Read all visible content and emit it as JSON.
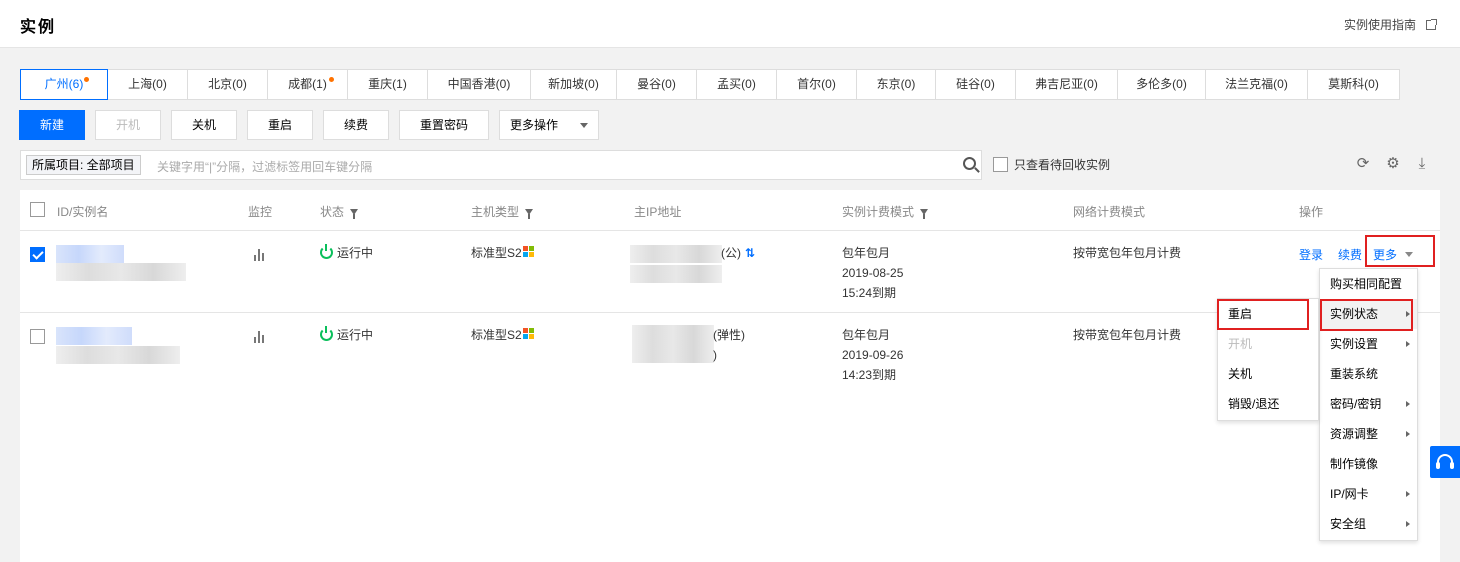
{
  "header": {
    "title": "实例",
    "guide_link": "实例使用指南"
  },
  "regions": [
    {
      "label": "广州(6)",
      "active": true,
      "dot": true
    },
    {
      "label": "上海(0)"
    },
    {
      "label": "北京(0)"
    },
    {
      "label": "成都(1)",
      "dot": true
    },
    {
      "label": "重庆(1)"
    },
    {
      "label": "中国香港(0)"
    },
    {
      "label": "新加坡(0)"
    },
    {
      "label": "曼谷(0)"
    },
    {
      "label": "孟买(0)"
    },
    {
      "label": "首尔(0)"
    },
    {
      "label": "东京(0)"
    },
    {
      "label": "硅谷(0)"
    },
    {
      "label": "弗吉尼亚(0)"
    },
    {
      "label": "多伦多(0)"
    },
    {
      "label": "法兰克福(0)"
    },
    {
      "label": "莫斯科(0)"
    }
  ],
  "toolbar": {
    "new": "新建",
    "start": "开机",
    "shutdown": "关机",
    "restart": "重启",
    "renew": "续费",
    "reset_password": "重置密码",
    "more_actions": "更多操作"
  },
  "search": {
    "tag": "所属项目: 全部项目",
    "placeholder": "关键字用“|”分隔，过滤标签用回车键分隔"
  },
  "recycle_label": "只查看待回收实例",
  "table": {
    "headers": {
      "id": "ID/实例名",
      "monitor": "监控",
      "status": "状态",
      "type": "主机类型",
      "ip": "主IP地址",
      "billing": "实例计费模式",
      "net_billing": "网络计费模式",
      "ops": "操作"
    },
    "rows": [
      {
        "status": "运行中",
        "type": "标准型S2",
        "ip_suffix": "(公)",
        "billing": "包年包月",
        "date": "2019-08-25",
        "expire": "15:24到期",
        "net_billing": "按带宽包年包月计费",
        "login": "登录",
        "renew": "续费",
        "more": "更多"
      },
      {
        "status": "运行中",
        "type": "标准型S2",
        "ip_suffix": "(弹性)",
        "ip_suffix2": ")",
        "billing": "包年包月",
        "date": "2019-09-26",
        "expire": "14:23到期",
        "net_billing": "按带宽包年包月计费"
      }
    ]
  },
  "more_menu": [
    {
      "label": "购买相同配置"
    },
    {
      "label": "实例状态",
      "submenu": true
    },
    {
      "label": "实例设置",
      "submenu": true
    },
    {
      "label": "重装系统"
    },
    {
      "label": "密码/密钥",
      "submenu": true
    },
    {
      "label": "资源调整",
      "submenu": true
    },
    {
      "label": "制作镜像"
    },
    {
      "label": "IP/网卡",
      "submenu": true
    },
    {
      "label": "安全组",
      "submenu": true
    }
  ],
  "status_submenu": [
    {
      "label": "重启"
    },
    {
      "label": "开机",
      "disabled": true
    },
    {
      "label": "关机"
    },
    {
      "label": "销毁/退还"
    }
  ],
  "colors": {
    "accent": "#006eff",
    "running": "#0abf5b",
    "highlight_box": "#e02020",
    "dot": "#ff7200"
  }
}
